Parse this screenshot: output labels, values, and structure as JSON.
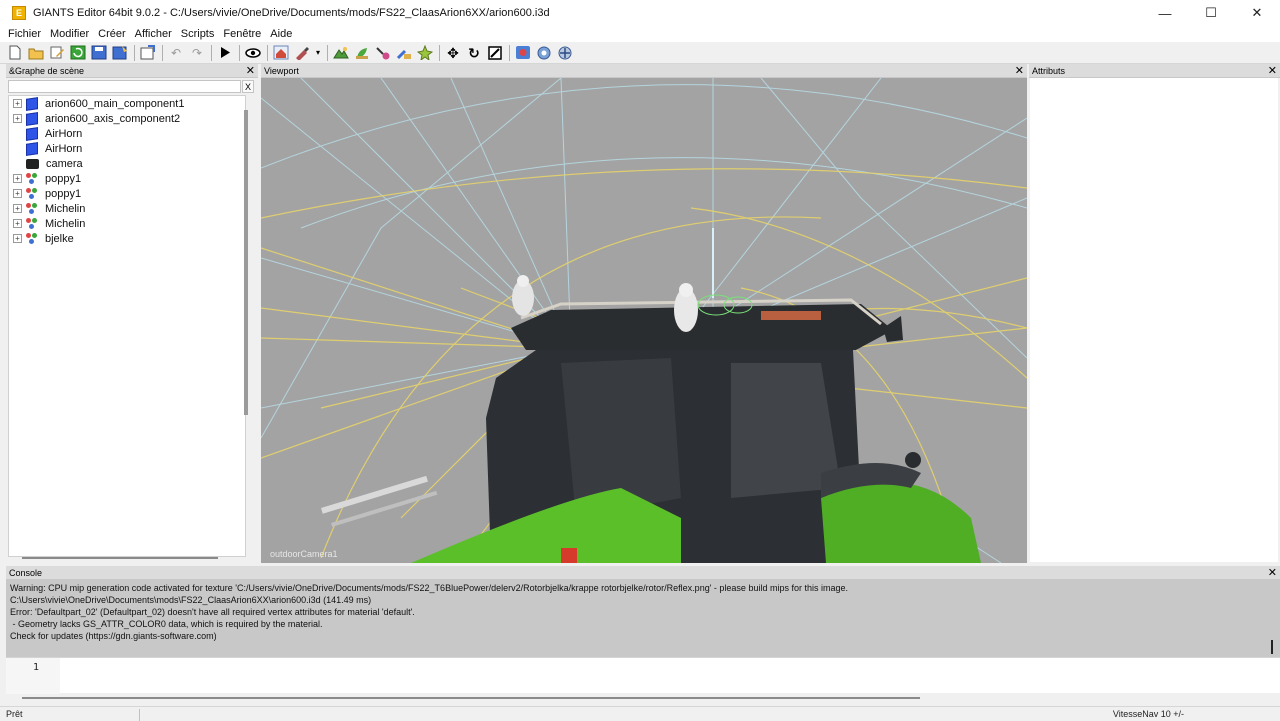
{
  "window": {
    "title": "GIANTS Editor 64bit 9.0.2 - C:/Users/vivie/OneDrive/Documents/mods/FS22_ClaasArion6XX/arion600.i3d",
    "app_icon_letter": "E",
    "minimize": "—",
    "maximize": "☐",
    "close": "✕"
  },
  "menu": {
    "items": [
      "Fichier",
      "Modifier",
      "Créer",
      "Afficher",
      "Scripts",
      "Fenêtre",
      "Aide"
    ]
  },
  "toolbar": {
    "icons": [
      "new-file-icon",
      "open-folder-icon",
      "edit-icon",
      "refresh-icon",
      "save-icon",
      "save-as-icon",
      "import-icon",
      "undo-icon",
      "redo-icon",
      "play-icon",
      "eye-icon",
      "camera-home-icon",
      "paint-icon",
      "terrain-icon",
      "foliage-icon",
      "brush-icon",
      "decal-icon",
      "move-icon",
      "rotate-icon",
      "scale-icon",
      "record-icon",
      "settings-icon",
      "gizmo-icon"
    ]
  },
  "scene_graph": {
    "title": "&Graphe de scène",
    "close": "✕",
    "search_placeholder": "",
    "clear_label": "X",
    "nodes": [
      {
        "label": "arion600_main_component1",
        "icon": "cube-icon",
        "expandable": true
      },
      {
        "label": "arion600_axis_component2",
        "icon": "cube-icon",
        "expandable": true
      },
      {
        "label": "AirHorn",
        "icon": "cube-icon",
        "expandable": false
      },
      {
        "label": "AirHorn",
        "icon": "cube-icon",
        "expandable": false
      },
      {
        "label": "camera",
        "icon": "camera-icon",
        "expandable": false
      },
      {
        "label": "poppy1",
        "icon": "transform-group-icon",
        "expandable": true
      },
      {
        "label": "poppy1",
        "icon": "transform-group-icon",
        "expandable": true
      },
      {
        "label": "Michelin",
        "icon": "transform-group-icon",
        "expandable": true
      },
      {
        "label": "Michelin",
        "icon": "transform-group-icon",
        "expandable": true
      },
      {
        "label": "bjelke",
        "icon": "transform-group-icon",
        "expandable": true
      }
    ]
  },
  "viewport": {
    "title": "Viewport",
    "close": "✕",
    "camera_label": "outdoorCamera1"
  },
  "attributes": {
    "title": "Attributs",
    "close": "✕"
  },
  "console": {
    "title": "Console",
    "close": "✕",
    "lines": [
      "Warning: CPU mip generation code activated for texture 'C:/Users/vivie/OneDrive/Documents/mods/FS22_T6BluePower/delerv2/Rotorbjelka/krappe rotorbjelke/rotor/Reflex.png' - please build mips for this image.",
      "C:\\Users\\vivie\\OneDrive\\Documents\\mods\\FS22_ClaasArion6XX\\arion600.i3d (141.49 ms)",
      "Error: 'Defaultpart_02' (Defaultpart_02) doesn't have all required vertex attributes for material 'default'.",
      " - Geometry lacks GS_ATTR_COLOR0 data, which is required by the material.",
      "Check for updates (https://gdn.giants-software.com)"
    ]
  },
  "script_editor": {
    "line_number": "1"
  },
  "status": {
    "left": "Prêt",
    "right": "VitesseNav 10 +/-"
  },
  "colors": {
    "viewport_bg": "#a3a3a3",
    "cube_blue": "#2f55e8",
    "debug_yellow": "#e6d36a",
    "debug_cyan": "#a9dbe8",
    "tractor_green": "#5bbf2a"
  }
}
